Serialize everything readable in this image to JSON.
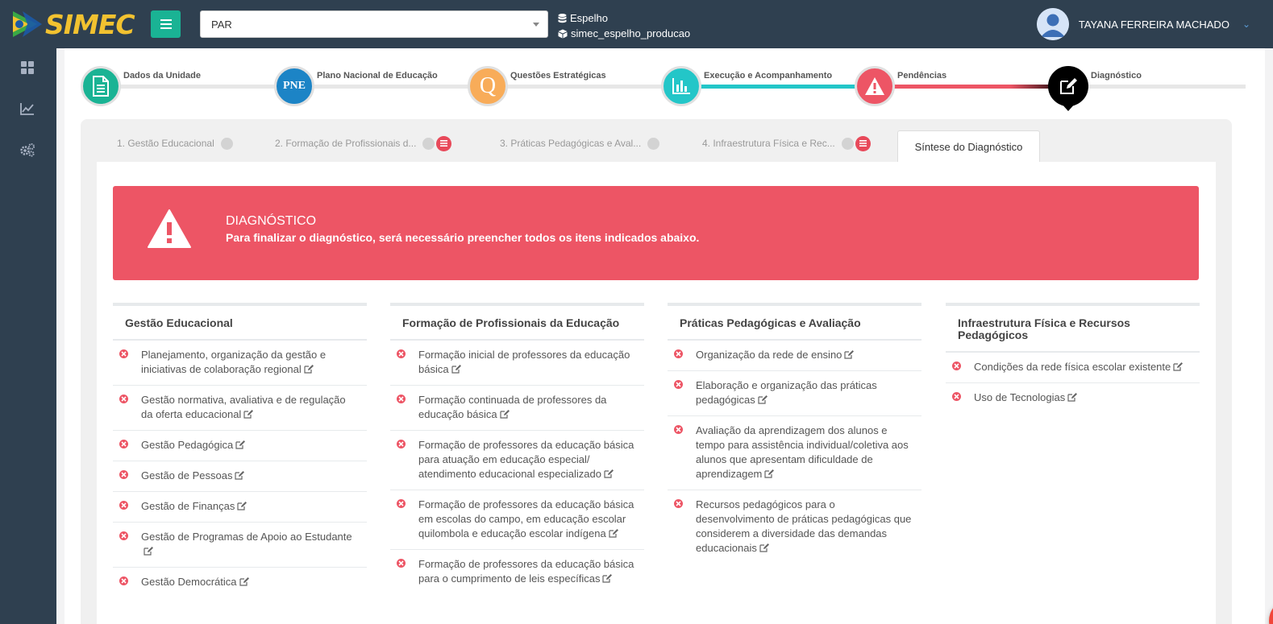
{
  "header": {
    "logo_text": "SIMEC",
    "system_select": {
      "value": "PAR"
    },
    "environment": {
      "name": "Espelho",
      "database": "simec_espelho_producao"
    },
    "user_name": "TAYANA FERREIRA MACHADO"
  },
  "sidebar": {
    "items": [
      {
        "icon": "dashboard-icon"
      },
      {
        "icon": "chart-line-icon"
      },
      {
        "icon": "gears-icon"
      }
    ]
  },
  "wizard": {
    "steps": [
      {
        "label": "Dados da Unidade",
        "icon": "document-icon",
        "color": "#1ab394"
      },
      {
        "label": "Plano Nacional de Educação",
        "icon_text": "PNE",
        "color": "#1c84c6"
      },
      {
        "label": "Questões Estratégicas",
        "icon_text": "Q",
        "color": "#f8ac59"
      },
      {
        "label": "Execução e Acompanhamento",
        "icon": "bar-chart-icon",
        "color": "#23c6c8"
      },
      {
        "label": "Pendências",
        "icon": "warning-icon",
        "color": "#ed5565"
      },
      {
        "label": "Diagnóstico",
        "icon": "edit-icon",
        "color": "#000000"
      }
    ]
  },
  "tabs": [
    {
      "label": "1. Gestão Educacional"
    },
    {
      "label": "2. Formação de Profissionais d..."
    },
    {
      "label": "3. Práticas Pedagógicas e Aval..."
    },
    {
      "label": "4. Infraestrutura Física e Rec..."
    },
    {
      "label": "Síntese do Diagnóstico"
    }
  ],
  "alert": {
    "title": "DIAGNÓSTICO",
    "message": "Para finalizar o diagnóstico, será necessário preencher todos os itens indicados abaixo.",
    "color": "#ed5565"
  },
  "columns": [
    {
      "title": "Gestão Educacional",
      "items": [
        "Planejamento, organização da gestão e iniciativas de colaboração regional",
        "Gestão normativa, avaliativa e de regulação da oferta educacional",
        "Gestão Pedagógica",
        "Gestão de Pessoas",
        "Gestão de Finanças",
        "Gestão de Programas de Apoio ao Estudante",
        "Gestão Democrática"
      ]
    },
    {
      "title": "Formação de Profissionais da Educação",
      "items": [
        "Formação inicial de professores da educação básica",
        "Formação continuada de professores da educação básica",
        "Formação de professores da educação básica para atuação em educação especial/ atendimento educacional especializado",
        "Formação de professores da educação básica em escolas do campo, em educação escolar quilombola e educação escolar indígena",
        "Formação de professores da educação básica para o cumprimento de leis específicas"
      ]
    },
    {
      "title": "Práticas Pedagógicas e Avaliação",
      "items": [
        "Organização da rede de ensino",
        "Elaboração e organização das práticas pedagógicas",
        "Avaliação da aprendizagem dos alunos e tempo para assistência individual/coletiva aos alunos que apresentam dificuldade de aprendizagem",
        "Recursos pedagógicos para o desenvolvimento de práticas pedagógicas que considerem a diversidade das demandas educacionais"
      ]
    },
    {
      "title": "Infraestrutura Física e Recursos Pedagógicos",
      "items": [
        "Condições da rede física escolar existente",
        "Uso de Tecnologias"
      ]
    }
  ]
}
